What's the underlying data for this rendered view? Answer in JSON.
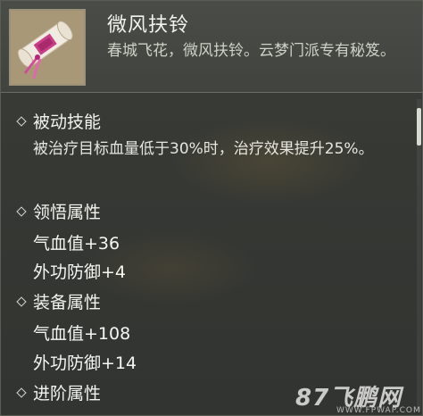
{
  "item": {
    "name": "微风扶铃",
    "description": "春城飞花，微风扶铃。云梦门派专有秘笈。",
    "icon": "scroll-icon"
  },
  "sections": {
    "passive": {
      "title": "被动技能",
      "text": "被治疗目标血量低于30%时，治疗效果提升25%。"
    },
    "comprehension": {
      "title": "领悟属性",
      "stats": [
        "气血值+36",
        "外功防御+4"
      ]
    },
    "equipment": {
      "title": "装备属性",
      "stats": [
        "气血值+108",
        "外功防御+14"
      ]
    },
    "advanced": {
      "title": "进阶属性"
    }
  },
  "watermark": {
    "text": "87飞鹏网",
    "url": "WWW.FPWAP.COM"
  }
}
